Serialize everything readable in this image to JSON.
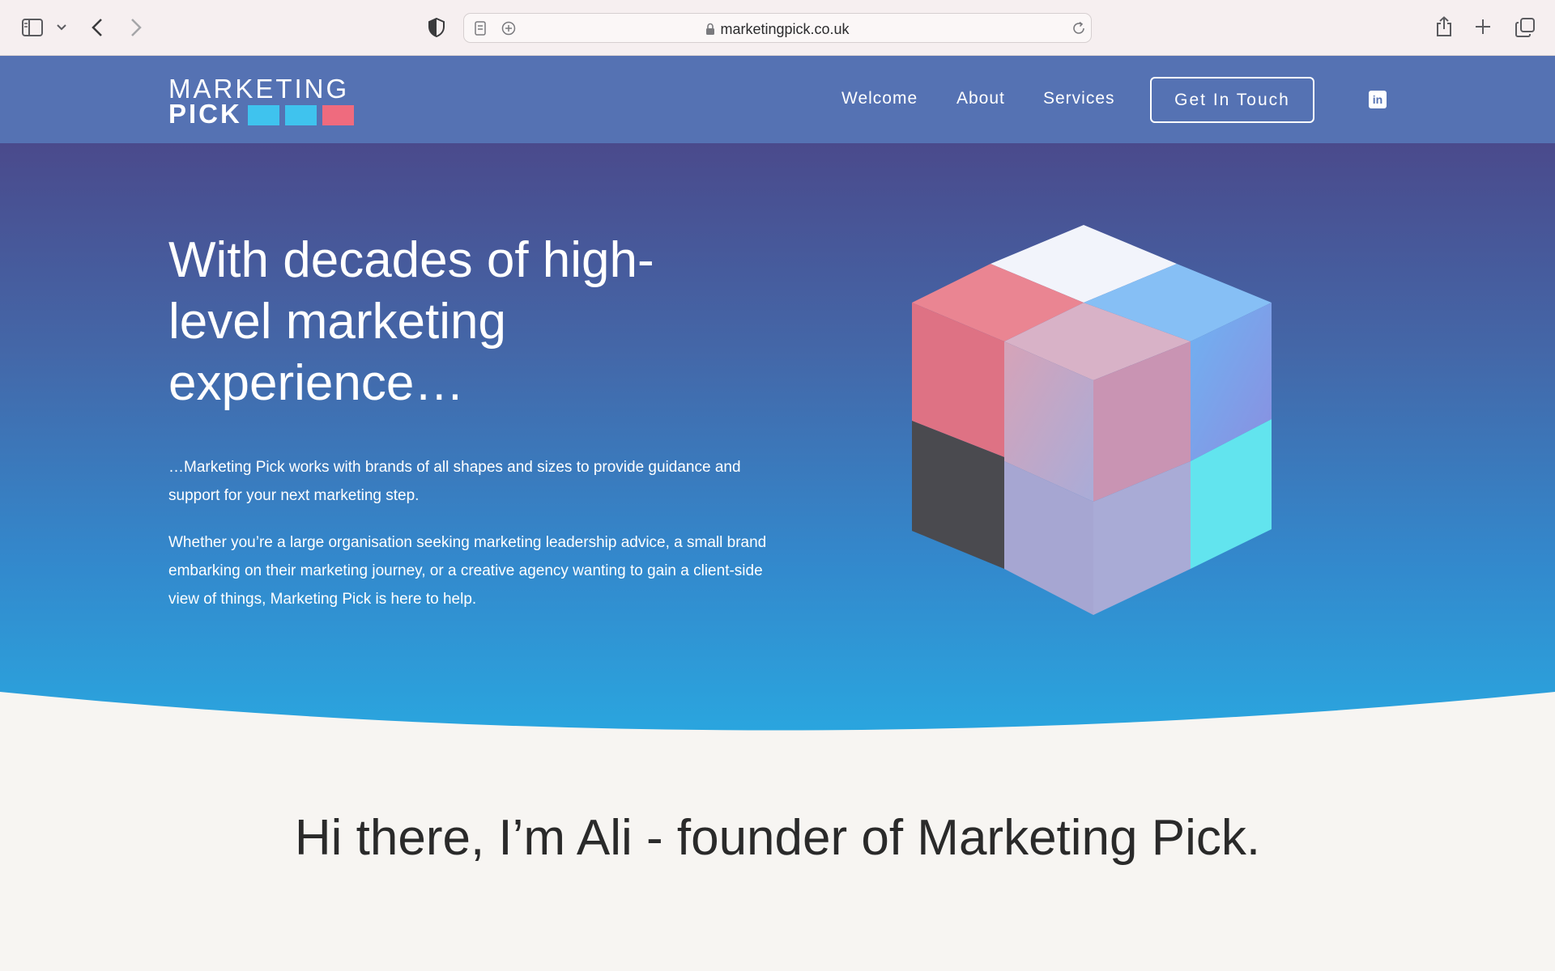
{
  "browser": {
    "url": "marketingpick.co.uk"
  },
  "brand": {
    "line1": "MARKETING",
    "line2": "PICK",
    "colors": {
      "square1": "#3fc3ee",
      "square2": "#3fc3ee",
      "square3": "#ef6b7e"
    }
  },
  "nav": {
    "items": [
      {
        "label": "Welcome"
      },
      {
        "label": "About"
      },
      {
        "label": "Services"
      }
    ],
    "cta_label": "Get In Touch",
    "social_icon": "linkedin-icon"
  },
  "hero": {
    "title": "With decades of high-level marketing experience…",
    "paragraph1": "…Marketing Pick works with brands of all shapes and sizes to provide guidance and support for your next marketing step.",
    "paragraph2": "Whether you’re a large organisation seeking marketing leadership advice, a small brand embarking on their marketing journey, or a creative agency wanting to gain a client-side view of things, Marketing Pick is here to help.",
    "colors": {
      "top": "#4a4a8c",
      "bottom": "#2aa6df"
    }
  },
  "intro": {
    "title": "Hi there, I’m Ali - founder of Marketing Pick."
  }
}
